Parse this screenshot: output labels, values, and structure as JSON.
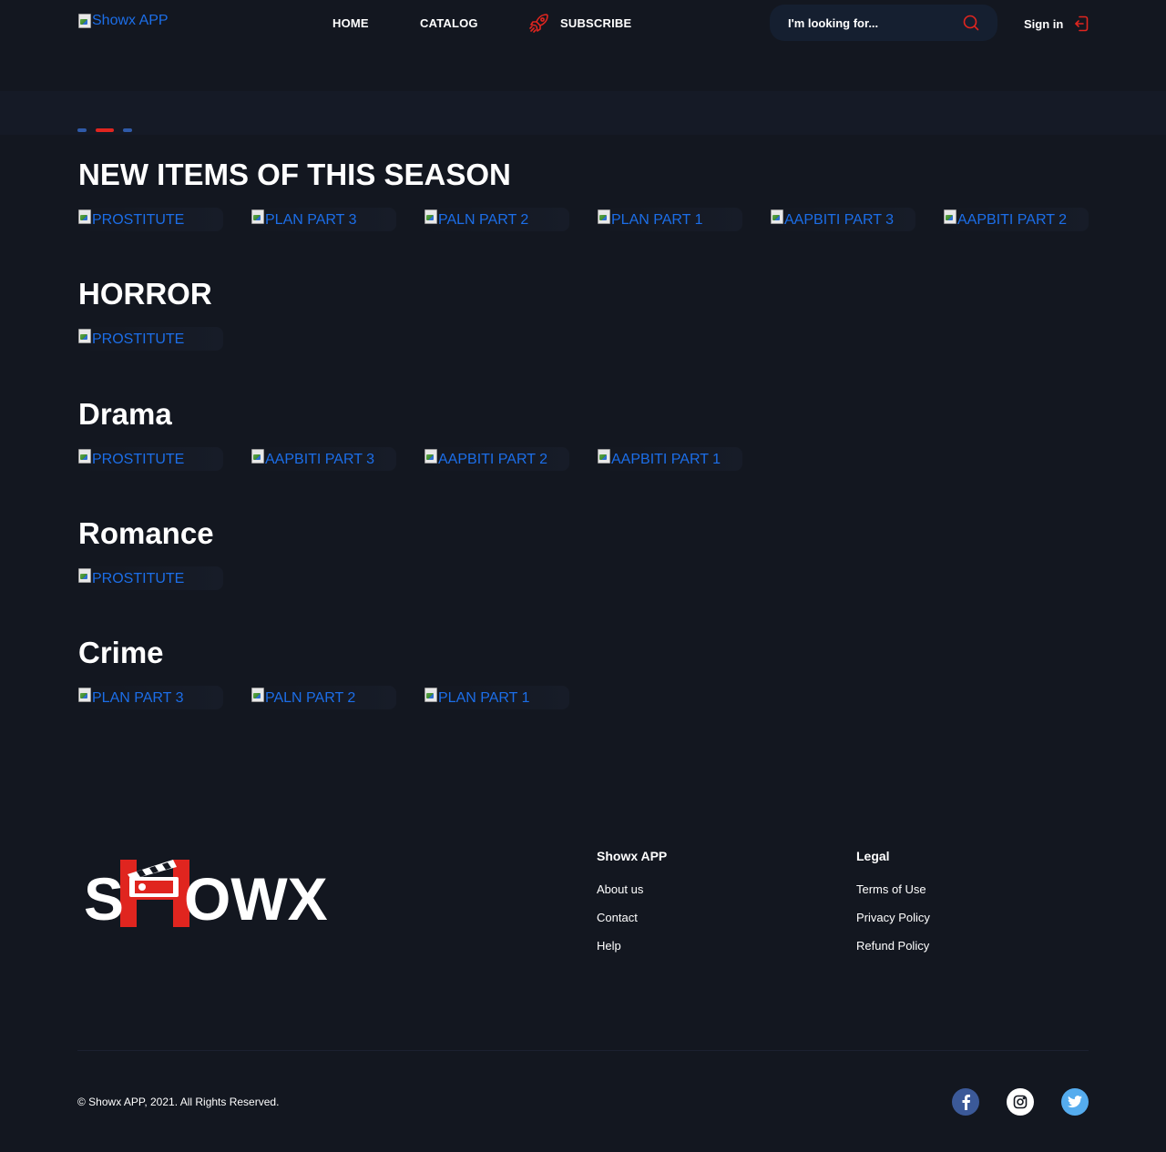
{
  "header": {
    "logo_alt": "Showx APP",
    "nav": {
      "home": "HOME",
      "catalog": "CATALOG",
      "subscribe": "SUBSCRIBE"
    },
    "search_placeholder": "I'm looking for...",
    "signin": "Sign in"
  },
  "colors": {
    "background": "#131720",
    "accent_red": "#e0251f",
    "link_blue": "#1c6ee8"
  },
  "sections": [
    {
      "title": "NEW ITEMS OF THIS SEASON",
      "items": [
        "PROSTITUTE",
        "PLAN PART 3",
        "PALN PART 2",
        "PLAN PART 1",
        "AAPBITI PART 3",
        "AAPBITI PART 2"
      ]
    },
    {
      "title": "HORROR",
      "items": [
        "PROSTITUTE"
      ]
    },
    {
      "title": "Drama",
      "items": [
        "PROSTITUTE",
        "AAPBITI PART 3",
        "AAPBITI PART 2",
        "AAPBITI PART 1"
      ]
    },
    {
      "title": "Romance",
      "items": [
        "PROSTITUTE"
      ]
    },
    {
      "title": "Crime",
      "items": [
        "PLAN PART 3",
        "PALN PART 2",
        "PLAN PART 1"
      ]
    }
  ],
  "footer": {
    "logo_text": "SHOWX",
    "col1": {
      "title": "Showx APP",
      "links": [
        "About us",
        "Contact",
        "Help"
      ]
    },
    "col2": {
      "title": "Legal",
      "links": [
        "Terms of Use",
        "Privacy Policy",
        "Refund Policy"
      ]
    },
    "copyright": "© Showx APP, 2021. All Rights Reserved.",
    "social": [
      "facebook-icon",
      "instagram-icon",
      "twitter-icon"
    ]
  }
}
